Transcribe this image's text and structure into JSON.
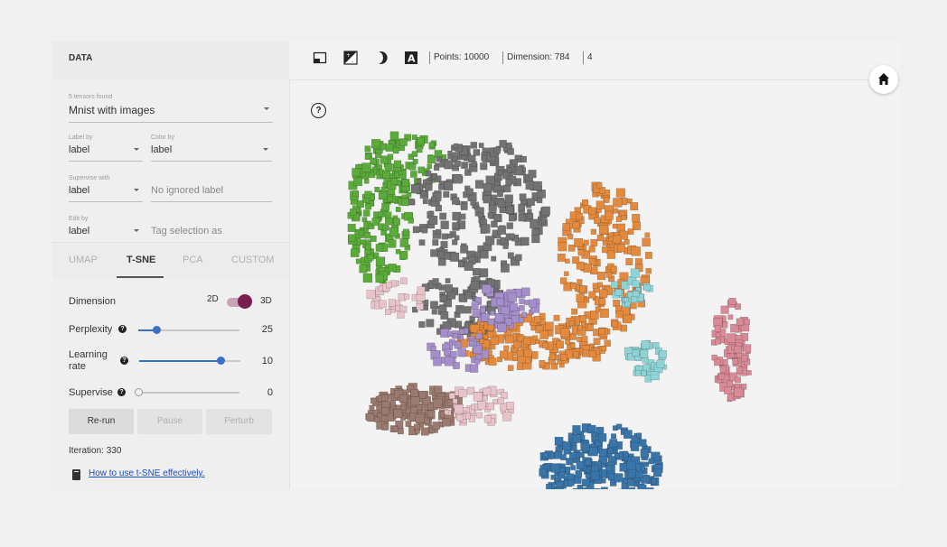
{
  "panel": {
    "title": "DATA",
    "tensors": {
      "label": "5 tensors found",
      "value": "Mnist with images"
    },
    "label_by": {
      "label": "Label by",
      "value": "label"
    },
    "color_by": {
      "label": "Color by",
      "value": "label"
    },
    "supervise_with": {
      "label": "Supervise with",
      "value": "label"
    },
    "ignored_label": {
      "placeholder": "No ignored label"
    },
    "edit_by": {
      "label": "Edit by",
      "value": "label"
    },
    "tag_selection": {
      "placeholder": "Tag selection as"
    }
  },
  "tabs": [
    {
      "label": "UMAP",
      "active": false
    },
    {
      "label": "T-SNE",
      "active": true
    },
    {
      "label": "PCA",
      "active": false
    },
    {
      "label": "CUSTOM",
      "active": false
    }
  ],
  "tsne": {
    "dimension_label": "Dimension",
    "dim_2d": "2D",
    "dim_3d": "3D",
    "dimension_value": "3D",
    "perplexity": {
      "label": "Perplexity",
      "value": 25,
      "fraction": 0.18
    },
    "learning_rate": {
      "label": "Learning rate",
      "value": 10,
      "fraction": 0.8
    },
    "supervise": {
      "label": "Supervise",
      "value": 0,
      "fraction": 0.0
    },
    "buttons": {
      "rerun": "Re-run",
      "pause": "Pause",
      "perturb": "Perturb"
    },
    "iteration": "Iteration: 330",
    "help_link": "How to use t-SNE effectively."
  },
  "toolbar": {
    "points": "Points: 10000",
    "dimension": "Dimension: 784",
    "extra": "4",
    "icons": [
      "select-box-icon",
      "contrast-icon",
      "night-mode-icon",
      "label-a-icon"
    ]
  },
  "colors": {
    "green": "#5aab3a",
    "gray": "#727272",
    "orange": "#e38a3e",
    "blue": "#3a75a9",
    "pink": "#d98a97",
    "brown": "#9b7a6f",
    "lavender": "#a58fcb",
    "teal": "#8fd3d6",
    "lightpink": "#e8c3c9",
    "olive": "#b5b83a",
    "accent_slider": "#3b6fc8",
    "accent_toggle": "#7a1e52"
  }
}
